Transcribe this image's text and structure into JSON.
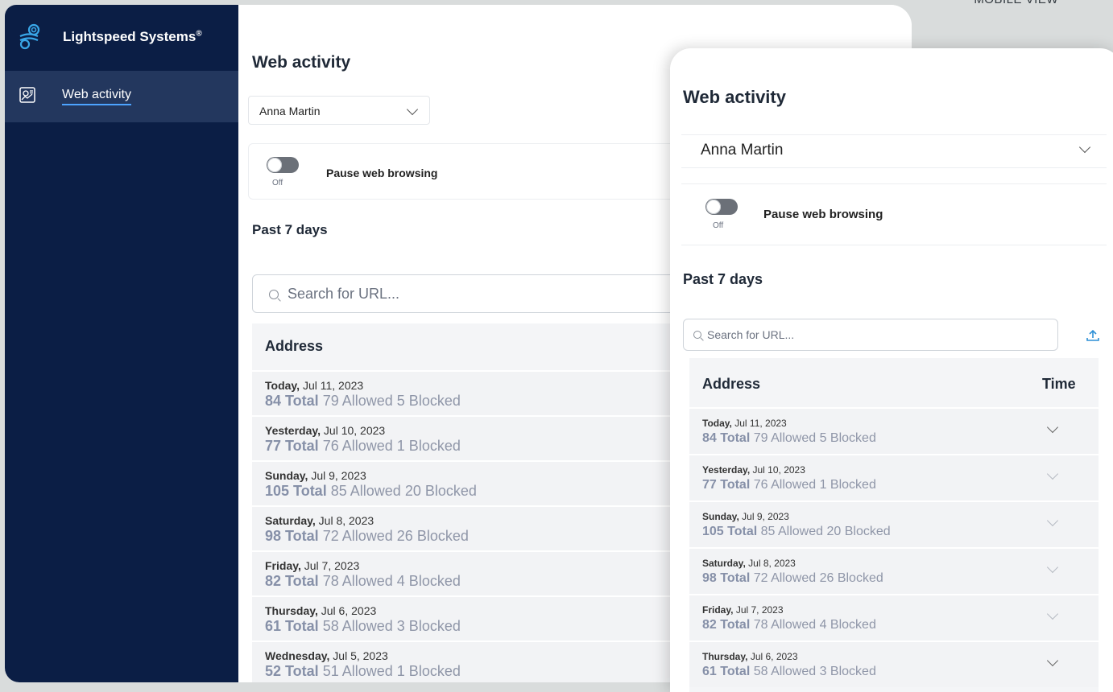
{
  "corner_label": "MOBILE VIEW",
  "sidebar": {
    "brand": "Lightspeed Systems",
    "brand_mark": "®",
    "nav": [
      {
        "label": "Web activity",
        "icon": "web-activity-icon",
        "active": true
      }
    ]
  },
  "page": {
    "title": "Web activity",
    "student": "Anna Martin",
    "pause_label": "Pause web browsing",
    "toggle_state": "Off",
    "section_title": "Past 7 days",
    "search_placeholder": "Search for URL...",
    "col_address": "Address",
    "col_time": "Time"
  },
  "days": [
    {
      "day": "Today,",
      "date": "Jul 11, 2023",
      "total": "84 Total",
      "allowed": "79 Allowed",
      "blocked": "5 Blocked"
    },
    {
      "day": "Yesterday,",
      "date": "Jul 10, 2023",
      "total": "77 Total",
      "allowed": "76 Allowed",
      "blocked": "1 Blocked"
    },
    {
      "day": "Sunday,",
      "date": "Jul 9, 2023",
      "total": "105 Total",
      "allowed": "85 Allowed",
      "blocked": "20 Blocked"
    },
    {
      "day": "Saturday,",
      "date": "Jul 8, 2023",
      "total": "98 Total",
      "allowed": "72 Allowed",
      "blocked": "26 Blocked"
    },
    {
      "day": "Friday,",
      "date": "Jul 7, 2023",
      "total": "82 Total",
      "allowed": "78 Allowed",
      "blocked": "4 Blocked"
    },
    {
      "day": "Thursday,",
      "date": "Jul 6, 2023",
      "total": "61 Total",
      "allowed": "58 Allowed",
      "blocked": "3 Blocked"
    },
    {
      "day": "Wednesday,",
      "date": "Jul 5, 2023",
      "total": "52 Total",
      "allowed": "51 Allowed",
      "blocked": "1 Blocked"
    }
  ],
  "colors": {
    "sidebar": "#0b1e45",
    "nav_active": "#23375e",
    "accent": "#4da3ff"
  }
}
